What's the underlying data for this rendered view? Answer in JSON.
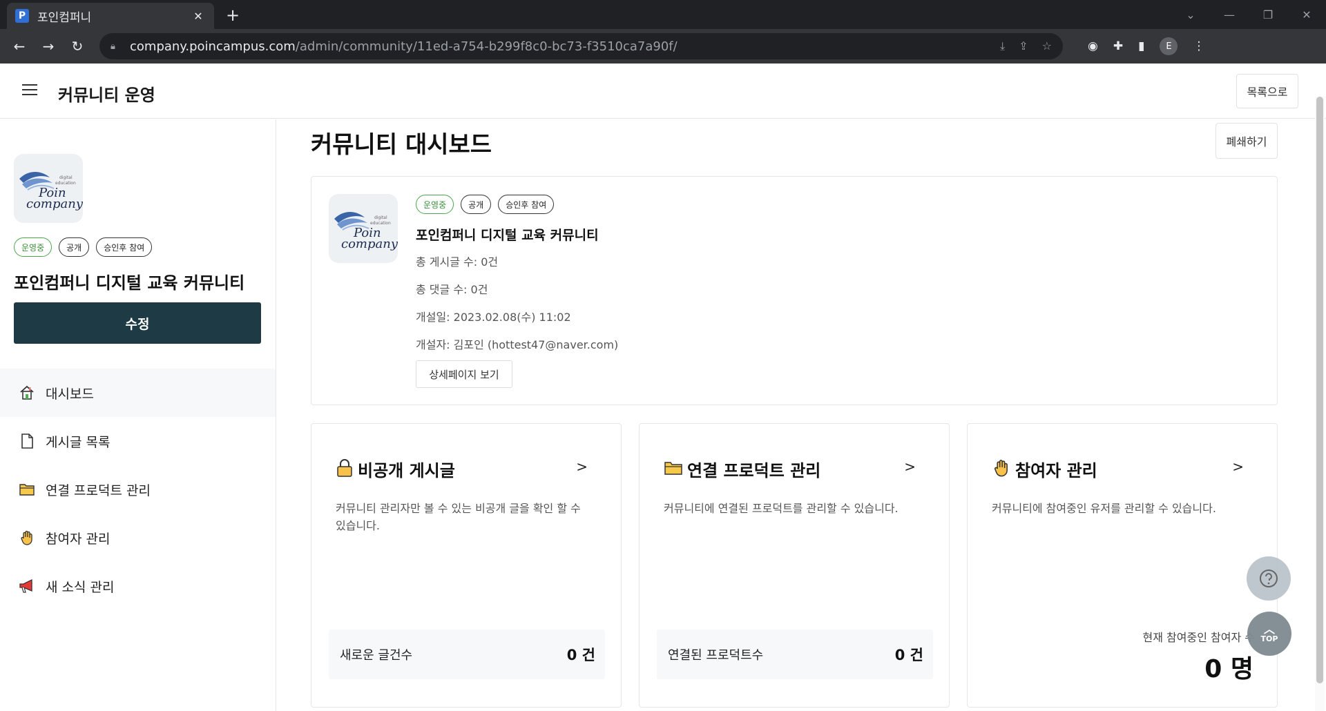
{
  "browser": {
    "tab_title": "포인컴퍼니",
    "favicon_letter": "P",
    "url_domain": "company.poincampus.com",
    "url_path": "/admin/community/11ed-a754-b299f8c0-bc73-f3510ca7a90f/",
    "profile_initial": "E"
  },
  "header": {
    "title": "커뮤니티 운영",
    "back_label": "목록으로"
  },
  "sidebar": {
    "badges": [
      "운영중",
      "공개",
      "승인후 참여"
    ],
    "community_name": "포인컴퍼니 디지털 교육 커뮤니티",
    "edit_label": "수정",
    "nav": [
      {
        "label": "대시보드",
        "icon": "home-icon",
        "active": true
      },
      {
        "label": "게시글 목록",
        "icon": "document-icon",
        "active": false
      },
      {
        "label": "연결 프로덕트 관리",
        "icon": "folder-icon",
        "active": false
      },
      {
        "label": "참여자 관리",
        "icon": "hand-icon",
        "active": false
      },
      {
        "label": "새 소식 관리",
        "icon": "megaphone-icon",
        "active": false
      }
    ]
  },
  "logo": {
    "word1": "Poin",
    "word2": "company",
    "small1": "digital",
    "small2": "education"
  },
  "main": {
    "page_title": "커뮤니티 대시보드",
    "close_label": "폐쇄하기",
    "info": {
      "badges": [
        "운영중",
        "공개",
        "승인후 참여"
      ],
      "name": "포인컴퍼니 디지털 교육 커뮤니티",
      "total_posts": "총 게시글 수: 0건",
      "total_comments": "총 댓글 수: 0건",
      "opened": "개설일: 2023.02.08(수) 11:02",
      "creator": "개설자: 김포인 (hottest47@naver.com)",
      "detail_label": "상세페이지 보기"
    },
    "cards": [
      {
        "title": "비공개 게시글",
        "icon": "lock-icon",
        "desc": "커뮤니티 관리자만 볼 수 있는 비공개 글을 확인 할 수 있습니다.",
        "stat_label": "새로운 글건수",
        "stat_value": "0 건"
      },
      {
        "title": "연결 프로덕트 관리",
        "icon": "folder-icon",
        "desc": "커뮤니티에 연결된 프로덕트를 관리할 수 있습니다.",
        "stat_label": "연결된 프로덕트수",
        "stat_value": "0 건"
      },
      {
        "title": "참여자 관리",
        "icon": "hand-icon",
        "desc": "커뮤니티에 참여중인 유저를 관리할 수 있습니다.",
        "stat_label": "현재 참여중인 참여자 수",
        "stat_value": "0 명"
      }
    ],
    "chevron": ">"
  },
  "fab": {
    "top_label": "TOP"
  },
  "colors": {
    "primary": "#1e3a44",
    "status_green": "#4ca64c",
    "chrome_dark": "#202124"
  }
}
